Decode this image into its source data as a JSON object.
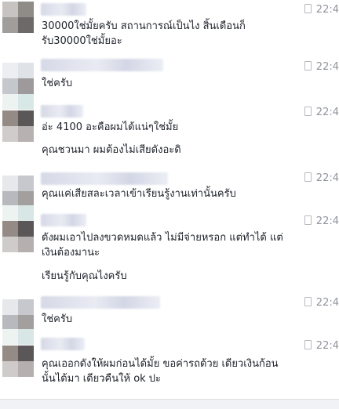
{
  "messages": [
    {
      "time": "22:4",
      "lines": [
        "30000ใช่มั้ยครับ สถานการณ์เป็นไง สิ้นเดือนก็",
        "รับ30000ใช่มั้ยอะ"
      ]
    },
    {
      "time": "22:4",
      "lines": [
        "ใช่ครับ"
      ]
    },
    {
      "time": "22:4",
      "lines": [
        "อ่ะ 4100 อะคือผมได้แน่ๆใช่มั้ย"
      ]
    },
    {
      "time": "",
      "lines": [
        "คุณชวนมา ผมต้องไม่เสียดังอะดิ"
      ]
    },
    {
      "time": "22:4",
      "lines": [
        "คุณแค่เสียสละเวลาเข้าเรียนรู้งานเท่านั้นครับ"
      ]
    },
    {
      "time": "22:4",
      "lines": [
        "ดังผมเอาไปลงขวดหมดแล้ว ไม่มีจ่ายหรอก แต่ทำได้ แต่",
        "เงินต้องมานะ"
      ]
    },
    {
      "time": "",
      "lines": [
        "เรียนรู้กับคุณไงครับ"
      ]
    },
    {
      "time": "22:4",
      "lines": [
        "ใช่ครับ"
      ]
    },
    {
      "time": "22:4",
      "lines": [
        "คุณเออกดังให้ผมก่อนได้มั้ย ขอค่ารถด้วย เดียวเงินก้อน",
        "นั้นได้มา เดียวคืนให้ ok ปะ"
      ]
    }
  ]
}
